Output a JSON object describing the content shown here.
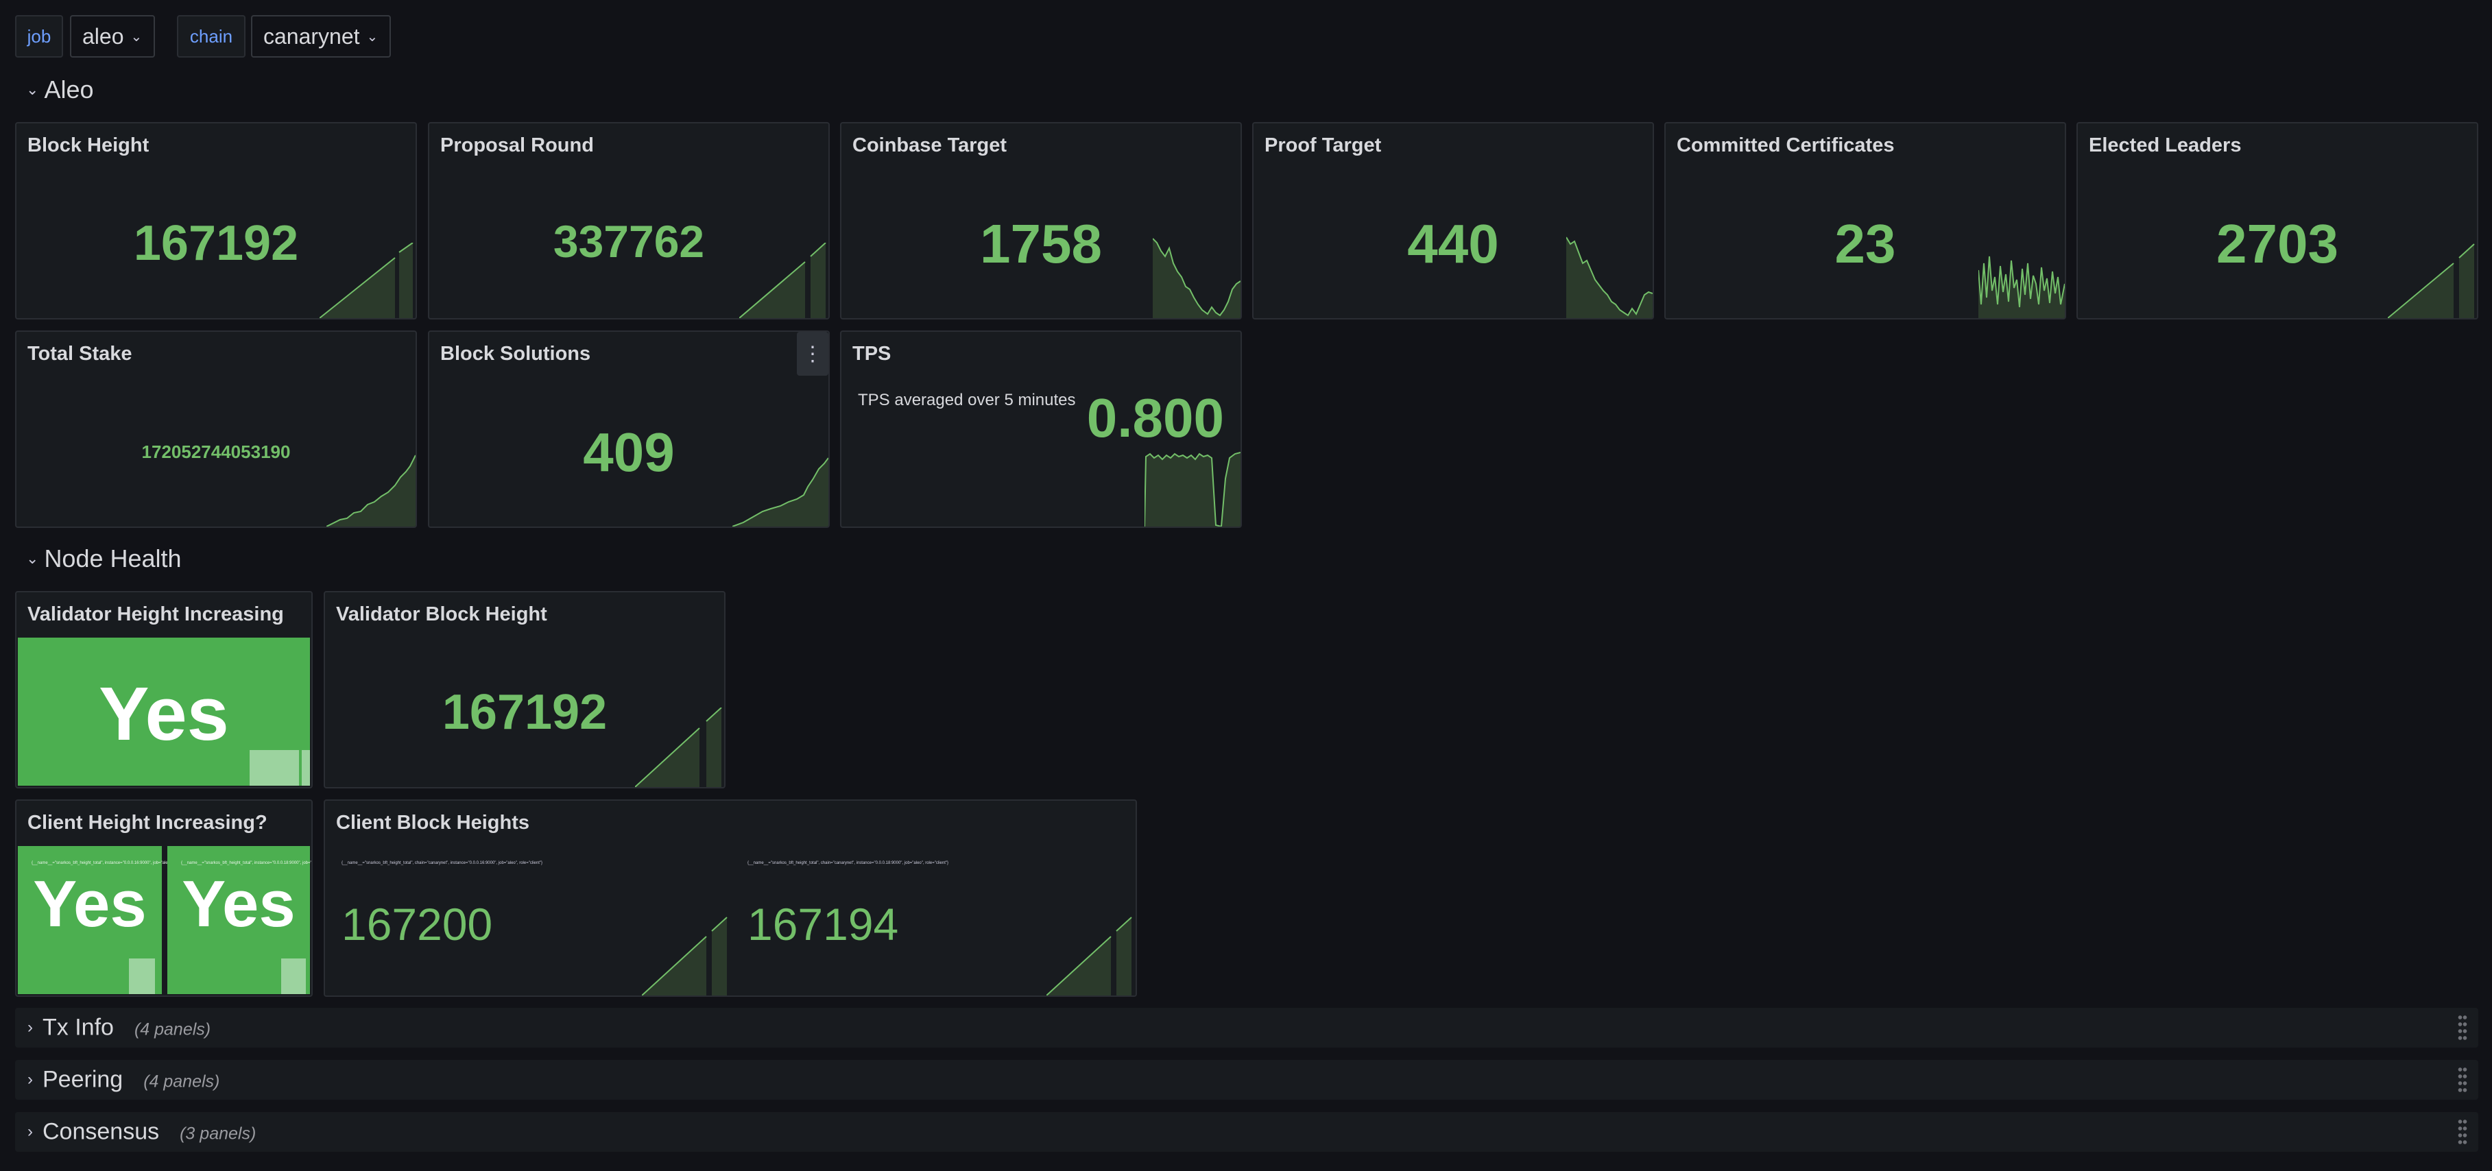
{
  "variables": {
    "job": {
      "label": "job",
      "value": "aleo"
    },
    "chain": {
      "label": "chain",
      "value": "canarynet"
    }
  },
  "rows": {
    "aleo": "Aleo",
    "node_health": "Node Health",
    "tx_info": {
      "title": "Tx Info",
      "count": "(4 panels)"
    },
    "peering": {
      "title": "Peering",
      "count": "(4 panels)"
    },
    "consensus": {
      "title": "Consensus",
      "count": "(3 panels)"
    }
  },
  "panels": {
    "block_height": {
      "title": "Block Height",
      "value": "167192"
    },
    "proposal_round": {
      "title": "Proposal Round",
      "value": "337762"
    },
    "coinbase_target": {
      "title": "Coinbase Target",
      "value": "1758"
    },
    "proof_target": {
      "title": "Proof Target",
      "value": "440"
    },
    "committed_certificates": {
      "title": "Committed Certificates",
      "value": "23"
    },
    "elected_leaders": {
      "title": "Elected Leaders",
      "value": "2703"
    },
    "total_stake": {
      "title": "Total Stake",
      "value": "172052744053190"
    },
    "block_solutions": {
      "title": "Block Solutions",
      "value": "409",
      "menu_icon": "kebab-menu-icon"
    },
    "tps": {
      "title": "TPS",
      "subtitle": "TPS averaged over 5 minutes",
      "value": "0.800"
    },
    "validator_height_increasing": {
      "title": "Validator Height Increasing",
      "value": "Yes"
    },
    "validator_block_height": {
      "title": "Validator Block Height",
      "value": "167192"
    },
    "client_height_increasing": {
      "title": "Client Height Increasing?",
      "values": [
        "Yes",
        "Yes"
      ]
    },
    "client_block_heights": {
      "title": "Client Block Heights",
      "series": [
        {
          "legend": "{__name__=\"snarkos_bft_height_total\", chain=\"canarynet\", instance=\"0.0.0.16:9000\", job=\"aleo\", role=\"client\"}",
          "value": "167200"
        },
        {
          "legend": "{__name__=\"snarkos_bft_height_total\", chain=\"canarynet\", instance=\"0.0.0.18:9000\", job=\"aleo\", role=\"client\"}",
          "value": "167194"
        }
      ]
    }
  },
  "colors": {
    "accent": "#73bf69",
    "background": "#111217",
    "panel": "#181b1f",
    "ok": "#4caf50"
  }
}
